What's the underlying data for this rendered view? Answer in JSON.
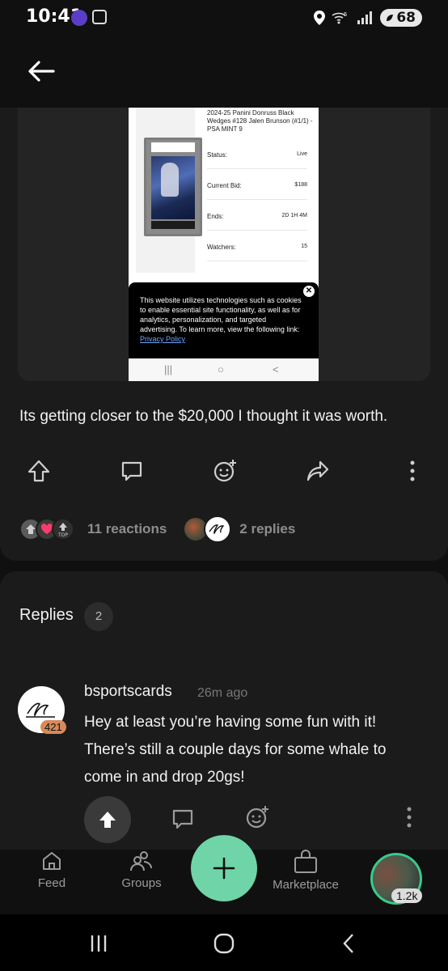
{
  "status_bar": {
    "time": "10:41",
    "wifi_label": "5",
    "battery": "68"
  },
  "post": {
    "listing": {
      "title": "2024-25 Panini Donruss Black Wedges #128 Jalen Brunson (#1/1) - PSA MINT 9",
      "rows": [
        {
          "key": "Status:",
          "value": "Live"
        },
        {
          "key": "Current Bid:",
          "value": "$188"
        },
        {
          "key": "Ends:",
          "value": "2D 1H 4M"
        },
        {
          "key": "Watchers:",
          "value": "15"
        }
      ],
      "cookie_text": "This website utilizes technologies such as cookies to enable essential site functionality, as well as for analytics, personalization, and targeted advertising. To learn more, view the following link: ",
      "cookie_link": "Privacy Policy"
    },
    "text": "Its getting closer to the $20,000 I thought it was worth.",
    "reactions_label": "11 reactions",
    "top_badge": "TOP",
    "replies_label": "2 replies"
  },
  "replies": {
    "title": "Replies",
    "count": "2",
    "items": [
      {
        "username": "bsportscards",
        "time": "26m ago",
        "score": "421",
        "body": "Hey at least you’re having some fun with it! There’s still a couple days for some whale to come in and drop 20gs!"
      }
    ]
  },
  "bottom_nav": {
    "feed": "Feed",
    "groups": "Groups",
    "marketplace": "Marketplace",
    "profile_badge": "1.2k"
  },
  "colors": {
    "accent": "#6fd4a7",
    "background": "#101010",
    "card": "#1b1b1b"
  }
}
